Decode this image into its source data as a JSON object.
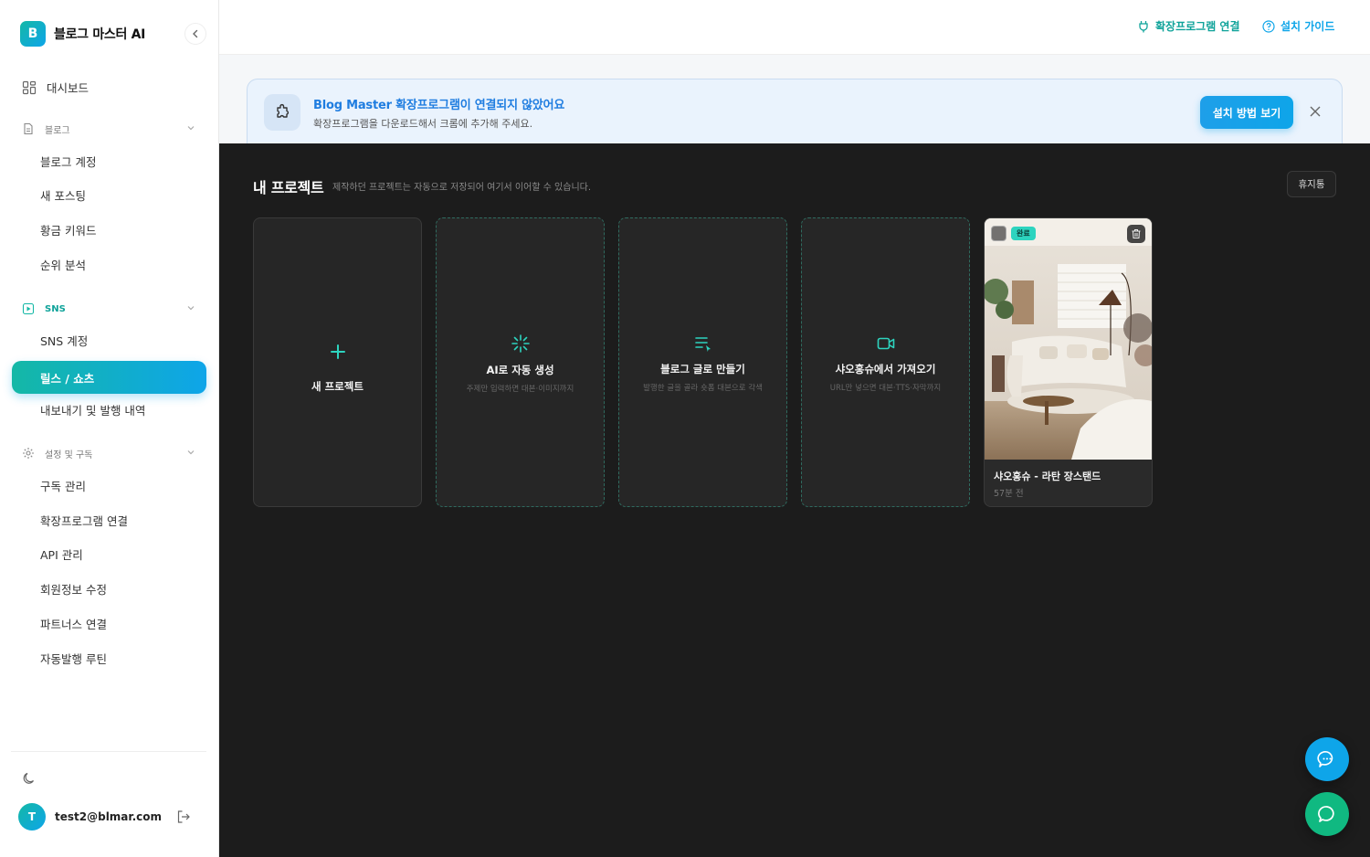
{
  "brand": {
    "logo_letter": "B",
    "name": "블로그 마스터 AI"
  },
  "sidebar": {
    "dashboard": "대시보드",
    "sections": [
      {
        "label": "블로그",
        "items": [
          "블로그 계정",
          "새 포스팅",
          "황금 키워드",
          "순위 분석"
        ]
      },
      {
        "label": "SNS",
        "items": [
          "SNS 계정",
          "릴스 / 쇼츠",
          "내보내기 및 발행 내역"
        ],
        "active_item": "릴스 / 쇼츠"
      },
      {
        "label": "설정 및 구독",
        "items": [
          "구독 관리",
          "확장프로그램 연결",
          "API 관리",
          "회원정보 수정",
          "파트너스 연결",
          "자동발행 루틴"
        ]
      }
    ],
    "user": {
      "avatar_letter": "T",
      "email": "test2@blmar.com"
    }
  },
  "topbar": {
    "extension_link": "확장프로그램 연결",
    "guide_link": "설치 가이드"
  },
  "banner": {
    "title": "Blog Master 확장프로그램이 연결되지 않았어요",
    "subtitle": "확장프로그램을 다운로드해서 크롬에 추가해 주세요.",
    "button": "설치 방법 보기"
  },
  "projects": {
    "title": "내 프로젝트",
    "description": "제작하던 프로젝트는 자동으로 저장되어 여기서 이어할 수 있습니다.",
    "trash_button": "휴지통",
    "new_card": {
      "label": "새 프로젝트"
    },
    "action_cards": [
      {
        "icon": "sparkle-icon",
        "title": "AI로 자동 생성",
        "subtitle": "주제만 입력하면 대본·이미지까지"
      },
      {
        "icon": "text-list-icon",
        "title": "블로그 글로 만들기",
        "subtitle": "발행한 글을 골라 숏폼 대본으로 각색"
      },
      {
        "icon": "video-icon",
        "title": "샤오홍슈에서 가져오기",
        "subtitle": "URL만 넣으면 대본·TTS·자막까지"
      }
    ],
    "project_card": {
      "badge": "완료",
      "title": "샤오홍슈 - 라탄 장스탠드",
      "time": "57분 전"
    }
  },
  "colors": {
    "accent_teal": "#14b8a6",
    "accent_blue": "#0ea5e9",
    "banner_title": "#1f7de0",
    "dark_bg": "#1c1c1c"
  }
}
